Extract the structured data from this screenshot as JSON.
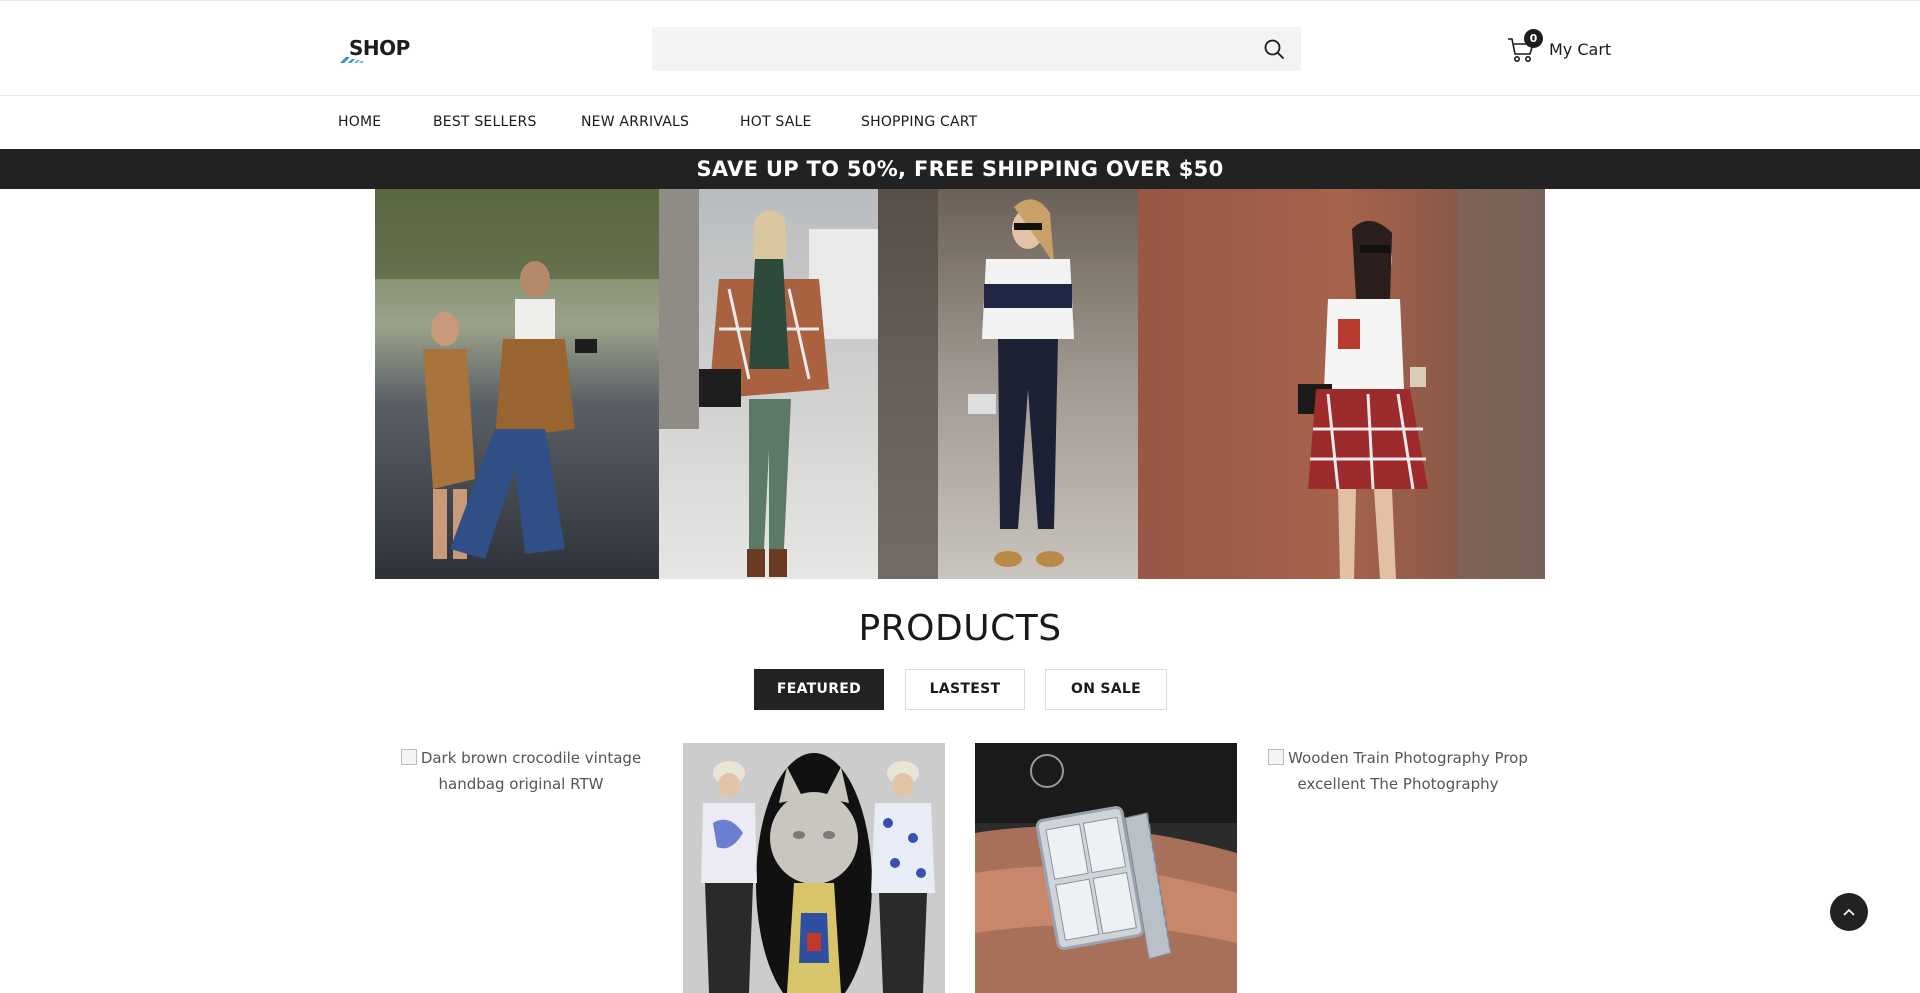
{
  "header": {
    "logo_text": "SHOP",
    "search": {
      "placeholder": "",
      "value": ""
    },
    "cart": {
      "count": "0",
      "label": "My Cart"
    }
  },
  "nav": {
    "items": [
      {
        "label": "HOME"
      },
      {
        "label": "BEST SELLERS"
      },
      {
        "label": "NEW ARRIVALS"
      },
      {
        "label": "HOT SALE"
      },
      {
        "label": "SHOPPING CART"
      }
    ]
  },
  "promo": {
    "text": "SAVE UP TO 50%, FREE SHIPPING OVER $50"
  },
  "banner": {
    "photos": [
      {
        "name": "street-style-photo-1"
      },
      {
        "name": "street-style-photo-2"
      },
      {
        "name": "street-style-photo-3"
      },
      {
        "name": "street-style-photo-4"
      }
    ]
  },
  "products": {
    "title": "PRODUCTS",
    "tabs": [
      {
        "label": "FEATURED",
        "active": true
      },
      {
        "label": "LASTEST",
        "active": false
      },
      {
        "label": "ON SALE",
        "active": false
      }
    ],
    "items": [
      {
        "alt": "Dark brown crocodile vintage handbag original RTW",
        "image_loaded": false
      },
      {
        "alt": "",
        "image_loaded": true
      },
      {
        "alt": "",
        "image_loaded": true
      },
      {
        "alt": "Wooden Train Photography Prop excellent The Photography",
        "image_loaded": false
      }
    ]
  },
  "colors": {
    "dark": "#222222",
    "search_bg": "#f3f3f3",
    "accent_blue": "#2d8fe0"
  }
}
